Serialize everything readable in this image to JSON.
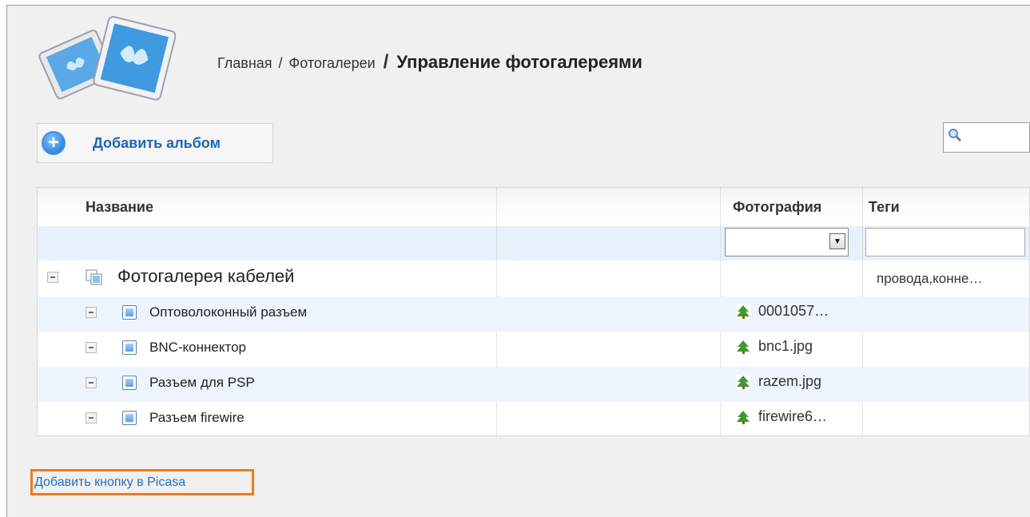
{
  "breadcrumb": {
    "home": "Главная",
    "separator": "/",
    "galleries": "Фотогалереи",
    "bold_separator": "/",
    "current": "Управление фотогалереями"
  },
  "toolbar": {
    "add_album_label": "Добавить альбом"
  },
  "search": {
    "icon": "search-icon"
  },
  "grid": {
    "columns": [
      "Название",
      "Фотография",
      "Теги"
    ],
    "rows": [
      {
        "level": 0,
        "name": "Фотогалерея кабелей",
        "photo": "",
        "tags": "провода,конне…",
        "icon": "gallery-icon"
      },
      {
        "level": 1,
        "name": "Оптоволоконный разъем",
        "photo": "0001057…",
        "tags": "",
        "icon": "album-icon"
      },
      {
        "level": 1,
        "name": "BNC-коннектор",
        "photo": "bnc1.jpg",
        "tags": "",
        "icon": "album-icon"
      },
      {
        "level": 1,
        "name": "Разъем для PSP",
        "photo": "razem.jpg",
        "tags": "",
        "icon": "album-icon"
      },
      {
        "level": 1,
        "name": "Разъем firewire",
        "photo": "firewire6…",
        "tags": "",
        "icon": "album-icon"
      }
    ]
  },
  "footer": {
    "picasa_link": "Добавить кнопку в Picasa"
  },
  "colors": {
    "link": "#1c66b8",
    "highlight_border": "#f07a1a",
    "row_alt": "#eef4fc",
    "panel_bg": "#f0f0f0"
  }
}
